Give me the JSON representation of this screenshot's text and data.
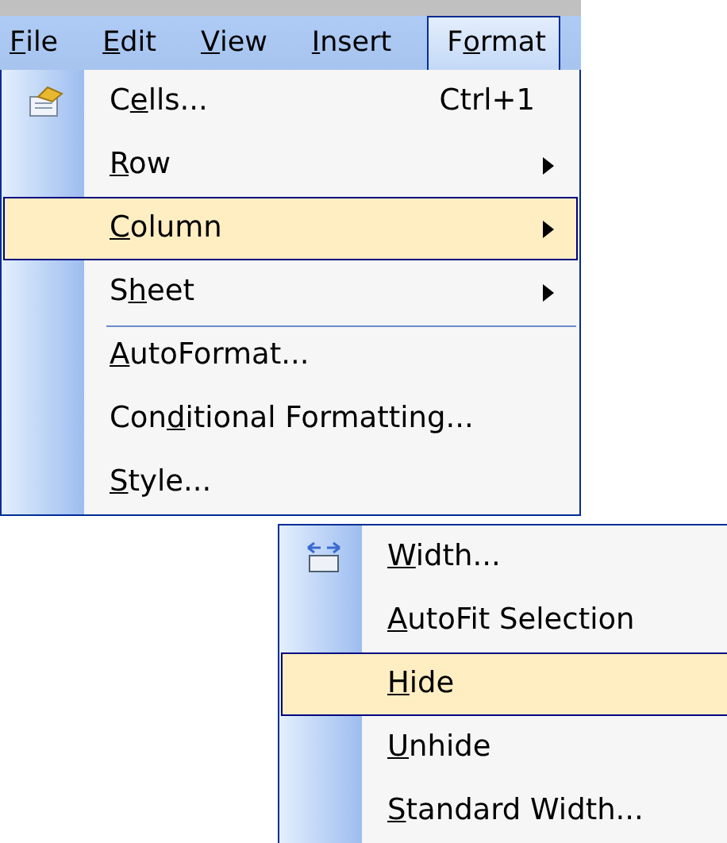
{
  "menu_bar": [
    {
      "key": "F",
      "post": "ile",
      "selected": false
    },
    {
      "key": "E",
      "post": "dit",
      "selected": false
    },
    {
      "key": "V",
      "post": "iew",
      "selected": false
    },
    {
      "key": "I",
      "post": "nsert",
      "selected": false
    },
    {
      "pre": "F",
      "key": "o",
      "post": "rmat",
      "selected": true
    }
  ],
  "format_menu": [
    {
      "kind": "cellscommand",
      "pre": "C",
      "key": "e",
      "post": "lls...",
      "shortcut": "Ctrl+1",
      "submenu": false,
      "separator_before": false,
      "selected": false
    },
    {
      "kind": "plain",
      "key": "R",
      "post": "ow",
      "submenu": true,
      "separator_before": false,
      "selected": false
    },
    {
      "kind": "plain",
      "key": "C",
      "post": "olumn",
      "submenu": true,
      "separator_before": false,
      "selected": true
    },
    {
      "kind": "plain",
      "pre": "S",
      "key": "h",
      "post": "eet",
      "submenu": true,
      "separator_before": false,
      "selected": false
    },
    {
      "kind": "plain",
      "key": "A",
      "post": "utoFormat...",
      "submenu": false,
      "separator_before": true,
      "selected": false
    },
    {
      "kind": "plain",
      "pre": "Con",
      "key": "d",
      "post": "itional Formatting...",
      "submenu": false,
      "separator_before": false,
      "selected": false
    },
    {
      "kind": "plain",
      "key": "S",
      "post": "tyle...",
      "submenu": false,
      "separator_before": false,
      "selected": false
    }
  ],
  "column_submenu": [
    {
      "kind": "widthcommand",
      "key": "W",
      "post": "idth...",
      "selected": false
    },
    {
      "kind": "plain",
      "key": "A",
      "post": "utoFit Selection",
      "selected": false
    },
    {
      "kind": "plain",
      "key": "H",
      "post": "ide",
      "selected": true
    },
    {
      "kind": "plain",
      "key": "U",
      "post": "nhide",
      "selected": false
    },
    {
      "kind": "plain",
      "key": "S",
      "post": "tandard Width...",
      "selected": false
    }
  ]
}
